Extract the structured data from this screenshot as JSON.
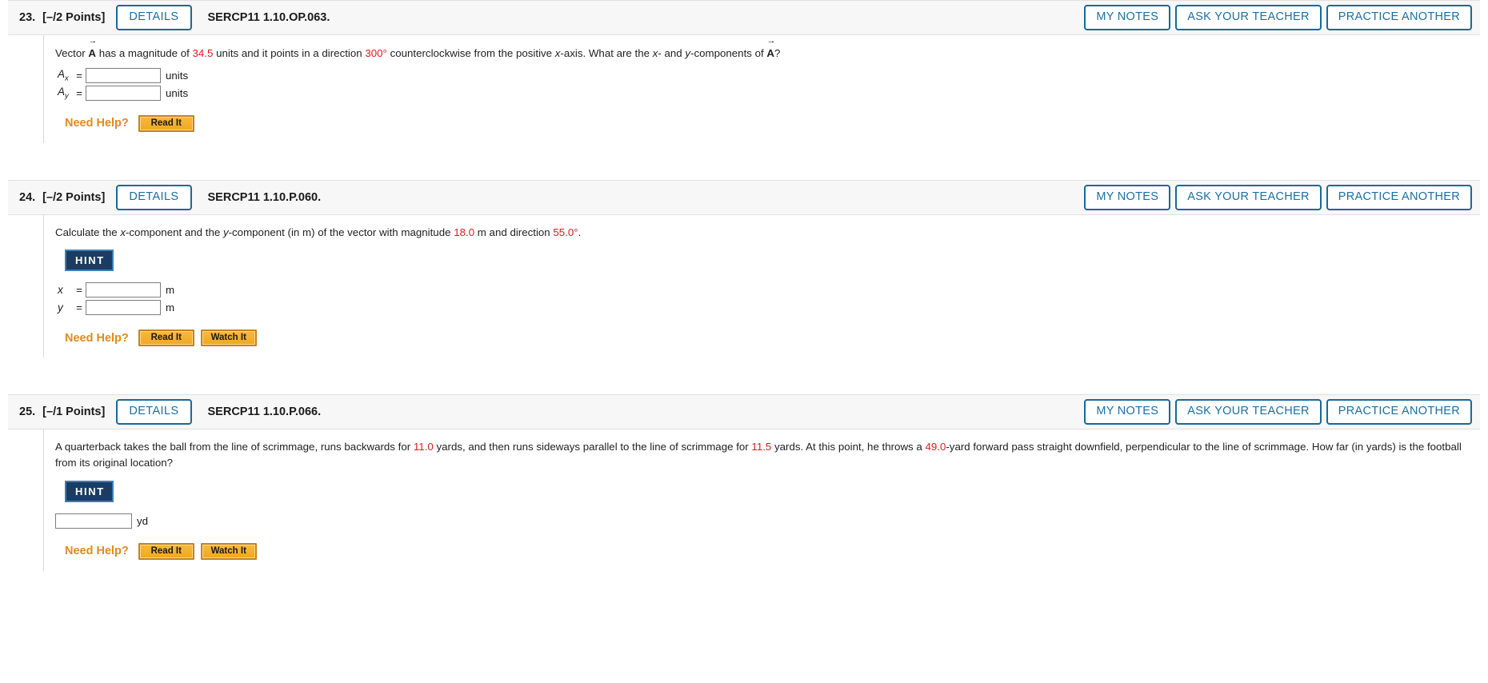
{
  "common": {
    "details_label": "DETAILS",
    "my_notes_label": "MY NOTES",
    "ask_teacher_label": "ASK YOUR TEACHER",
    "practice_another_label": "PRACTICE ANOTHER",
    "need_help_label": "Need Help?",
    "read_it_label": "Read It",
    "watch_it_label": "Watch It",
    "hint_label": "HINT",
    "equals": "=",
    "accent_blue": "#1a6fa8",
    "accent_orange": "#e8891b",
    "value_red": "#e01b1b",
    "hint_navy": "#1b3d63",
    "header_bg": "#f7f7f7"
  },
  "questions": [
    {
      "number": "23.",
      "points": "[–/2 Points]",
      "code": "SERCP11 1.10.OP.063.",
      "has_hint": false,
      "prompt_parts": [
        {
          "t": "text",
          "v": "Vector "
        },
        {
          "t": "vec",
          "v": "A"
        },
        {
          "t": "text",
          "v": " has a magnitude of "
        },
        {
          "t": "num",
          "v": "34.5"
        },
        {
          "t": "text",
          "v": " units and it points in a direction "
        },
        {
          "t": "num",
          "v": "300°"
        },
        {
          "t": "text",
          "v": " counterclockwise from the positive "
        },
        {
          "t": "var",
          "v": "x"
        },
        {
          "t": "text",
          "v": "-axis. What are the "
        },
        {
          "t": "var",
          "v": "x"
        },
        {
          "t": "text",
          "v": "- and "
        },
        {
          "t": "var",
          "v": "y"
        },
        {
          "t": "text",
          "v": "-components of "
        },
        {
          "t": "vec",
          "v": "A"
        },
        {
          "t": "text",
          "v": "?"
        }
      ],
      "answers": [
        {
          "label": "A",
          "sub": "x",
          "value": "",
          "unit": "units"
        },
        {
          "label": "A",
          "sub": "y",
          "value": "",
          "unit": "units"
        }
      ],
      "help_buttons": [
        "Read It"
      ]
    },
    {
      "number": "24.",
      "points": "[–/2 Points]",
      "code": "SERCP11 1.10.P.060.",
      "has_hint": true,
      "prompt_parts": [
        {
          "t": "text",
          "v": "Calculate the "
        },
        {
          "t": "var",
          "v": "x"
        },
        {
          "t": "text",
          "v": "-component and the "
        },
        {
          "t": "var",
          "v": "y"
        },
        {
          "t": "text",
          "v": "-component (in m) of the vector with magnitude "
        },
        {
          "t": "num",
          "v": "18.0"
        },
        {
          "t": "text",
          "v": " m and direction "
        },
        {
          "t": "num",
          "v": "55.0°"
        },
        {
          "t": "text",
          "v": "."
        }
      ],
      "answers": [
        {
          "label": "x",
          "sub": "",
          "value": "",
          "unit": "m"
        },
        {
          "label": "y",
          "sub": "",
          "value": "",
          "unit": "m"
        }
      ],
      "help_buttons": [
        "Read It",
        "Watch It"
      ]
    },
    {
      "number": "25.",
      "points": "[–/1 Points]",
      "code": "SERCP11 1.10.P.066.",
      "has_hint": true,
      "prompt_parts": [
        {
          "t": "text",
          "v": "A quarterback takes the ball from the line of scrimmage, runs backwards for "
        },
        {
          "t": "num",
          "v": "11.0"
        },
        {
          "t": "text",
          "v": " yards, and then runs sideways parallel to the line of scrimmage for "
        },
        {
          "t": "num",
          "v": "11.5"
        },
        {
          "t": "text",
          "v": " yards. At this point, he throws a "
        },
        {
          "t": "num",
          "v": "49.0"
        },
        {
          "t": "text",
          "v": "-yard forward pass straight downfield, perpendicular to the line of scrimmage. How far (in yards) is the football from its original location?"
        }
      ],
      "answers": [
        {
          "label": "",
          "sub": "",
          "value": "",
          "unit": "yd"
        }
      ],
      "help_buttons": [
        "Read It",
        "Watch It"
      ]
    }
  ]
}
